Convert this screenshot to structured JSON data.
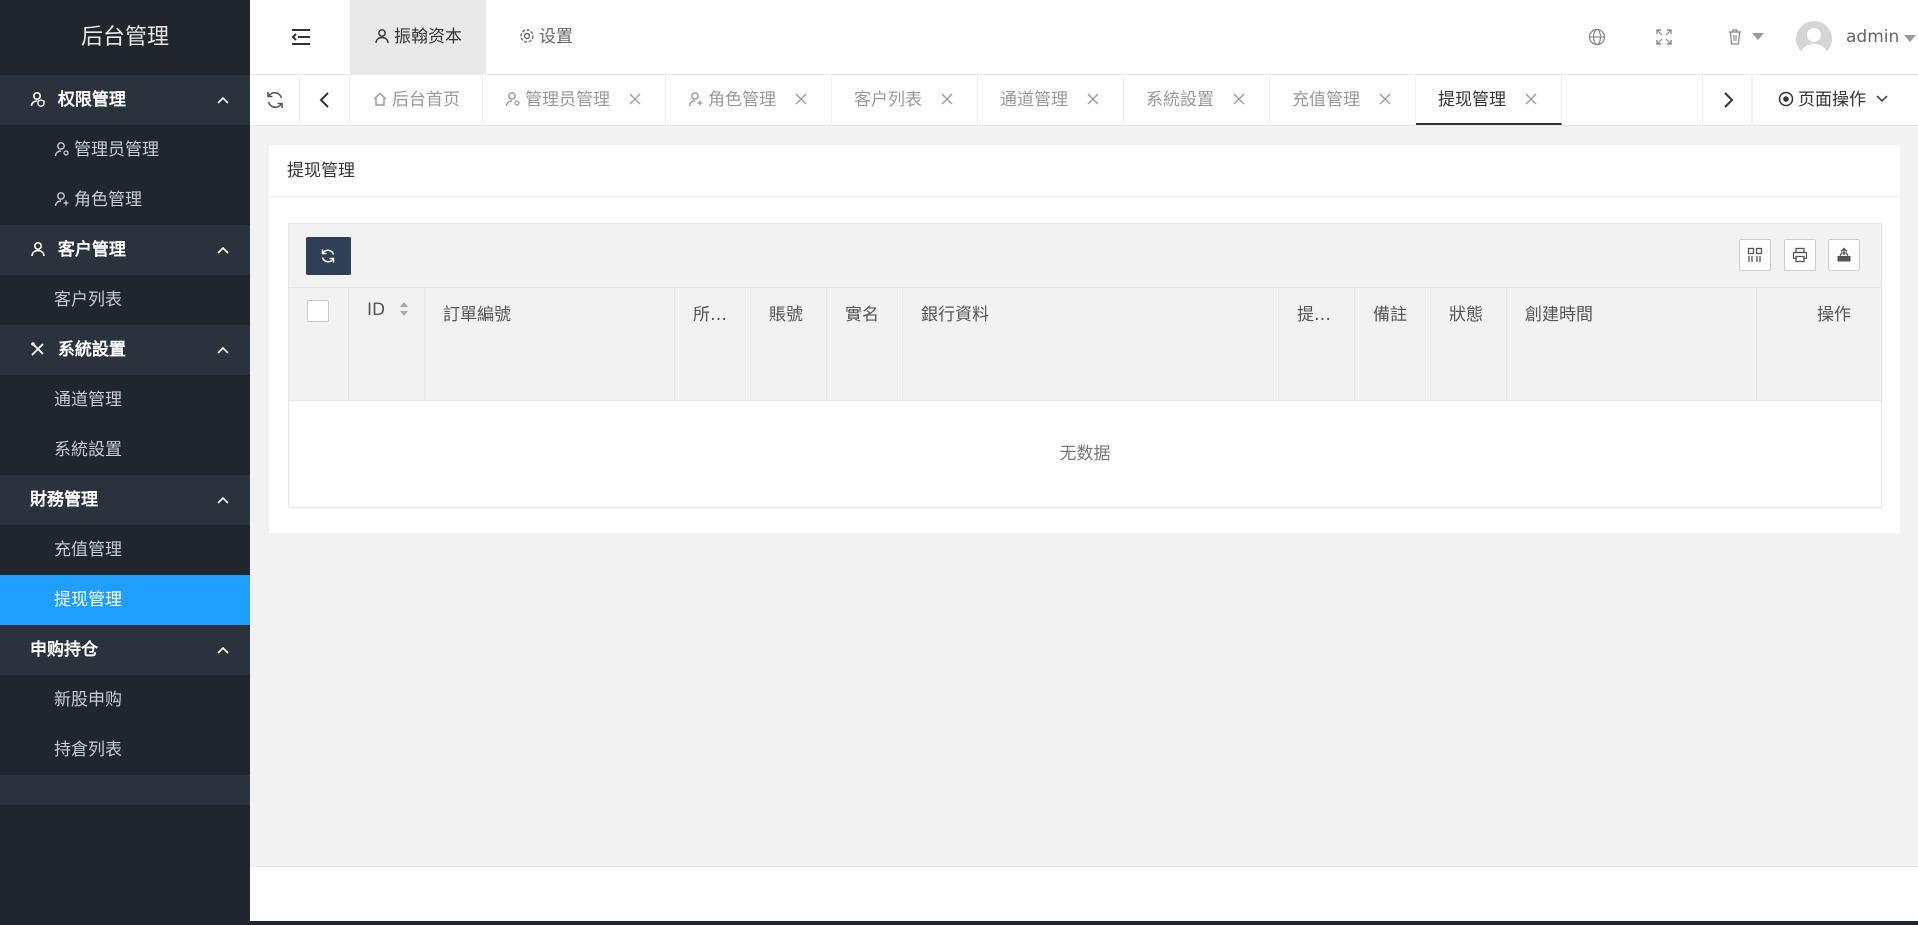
{
  "sidebar": {
    "logo": "后台管理",
    "groups": [
      {
        "title": "权限管理",
        "icon": "user-shield-icon",
        "items": [
          "管理员管理",
          "角色管理"
        ]
      },
      {
        "title": "客户管理",
        "icon": "user-icon",
        "items": [
          "客户列表"
        ]
      },
      {
        "title": "系統設置",
        "icon": "tools-icon",
        "items": [
          "通道管理",
          "系統設置"
        ]
      },
      {
        "title": "財務管理",
        "icon": "",
        "items": [
          "充值管理",
          "提现管理"
        ]
      },
      {
        "title": "申购持仓",
        "icon": "",
        "items": [
          "新股申购",
          "持倉列表"
        ]
      }
    ],
    "active_item": "提现管理"
  },
  "header": {
    "top_tabs": [
      "振翰资本",
      "设置"
    ],
    "username": "admin"
  },
  "tabstrip": {
    "tabs": [
      "后台首页",
      "管理员管理",
      "角色管理",
      "客户列表",
      "通道管理",
      "系統設置",
      "充值管理",
      "提现管理"
    ],
    "page_ops": "页面操作"
  },
  "content": {
    "title": "提现管理",
    "columns": [
      "ID",
      "訂單編號",
      "所…",
      "賬號",
      "實名",
      "銀行資料",
      "提…",
      "備註",
      "狀態",
      "創建時間",
      "操作"
    ],
    "empty_text": "无数据"
  },
  "colors": {
    "sidebar_bg": "#1f262d",
    "group_bg": "#2a333d",
    "active_blue": "#1e9fff",
    "refresh_btn": "#2f4056"
  }
}
